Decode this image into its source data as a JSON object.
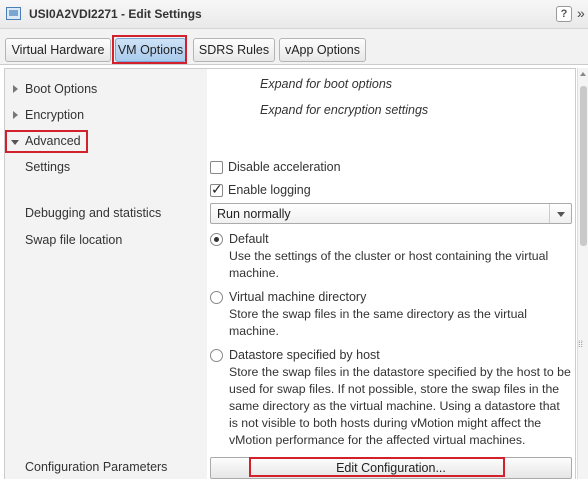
{
  "window": {
    "title": "USI0A2VDI2271 - Edit Settings",
    "help": "?",
    "more": "»"
  },
  "tabs": [
    {
      "label": "Virtual Hardware"
    },
    {
      "label": "VM Options"
    },
    {
      "label": "SDRS Rules"
    },
    {
      "label": "vApp Options"
    }
  ],
  "sections": {
    "boot": {
      "label": "Boot Options",
      "hint": "Expand for boot options"
    },
    "encryption": {
      "label": "Encryption",
      "hint": "Expand for encryption settings"
    },
    "advanced": {
      "label": "Advanced"
    }
  },
  "advanced": {
    "settings": {
      "label": "Settings",
      "disable_acceleration": {
        "label": "Disable acceleration",
        "checked": false
      },
      "enable_logging": {
        "label": "Enable logging",
        "checked": true
      }
    },
    "debugging": {
      "label": "Debugging and statistics",
      "value": "Run normally"
    },
    "swap": {
      "label": "Swap file location",
      "options": [
        {
          "label": "Default",
          "selected": true,
          "desc": [
            "Use the settings of the cluster or host containing the virtual",
            "machine."
          ]
        },
        {
          "label": "Virtual machine directory",
          "selected": false,
          "desc": [
            "Store the swap files in the same directory as the virtual",
            "machine."
          ]
        },
        {
          "label": "Datastore specified by host",
          "selected": false,
          "desc": [
            "Store the swap files in the datastore specified by the host to be",
            "used for swap files. If not possible, store the swap files in the",
            "same directory as the virtual machine. Using a datastore that",
            "is not visible to both hosts during vMotion might affect the",
            "vMotion performance for the affected virtual machines."
          ]
        }
      ]
    },
    "config": {
      "label": "Configuration Parameters",
      "button": "Edit Configuration..."
    }
  },
  "colors": {
    "highlight": "#d2202c",
    "active_tab": "#a9cbee"
  }
}
